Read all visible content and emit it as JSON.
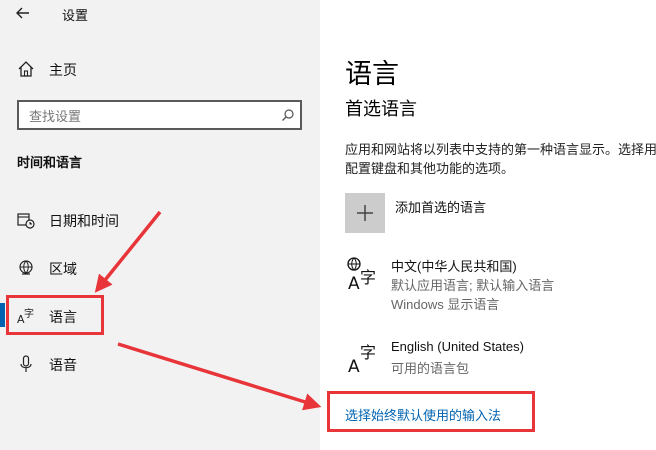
{
  "window": {
    "title": "设置",
    "back_icon": "arrow-left-icon"
  },
  "sidebar": {
    "home": {
      "label": "主页",
      "icon": "home-icon"
    },
    "search": {
      "placeholder": "查找设置",
      "value": "",
      "icon": "search-icon"
    },
    "section_heading": "时间和语言",
    "items": [
      {
        "label": "日期和时间",
        "icon": "calendar-clock-icon"
      },
      {
        "label": "区域",
        "icon": "globe-region-icon"
      },
      {
        "label": "语言",
        "icon": "language-icon",
        "active": true
      },
      {
        "label": "语音",
        "icon": "microphone-icon"
      }
    ]
  },
  "main": {
    "title": "语言",
    "subtitle": "首选语言",
    "description": "应用和网站将以列表中支持的第一种语言显示。选择用于配置键盘和其他功能的选项。",
    "add_language_label": "添加首选的语言",
    "languages": [
      {
        "name": "中文(中华人民共和国)",
        "details": [
          "默认应用语言; 默认输入语言",
          "Windows 显示语言"
        ]
      },
      {
        "name": "English (United States)",
        "details": [
          "可用的语言包"
        ]
      }
    ],
    "input_method_link": "选择始终默认使用的输入法"
  },
  "colors": {
    "accent": "#0063b1",
    "annotation": "#e8353a",
    "sidebar_bg": "#f2f2f2"
  }
}
